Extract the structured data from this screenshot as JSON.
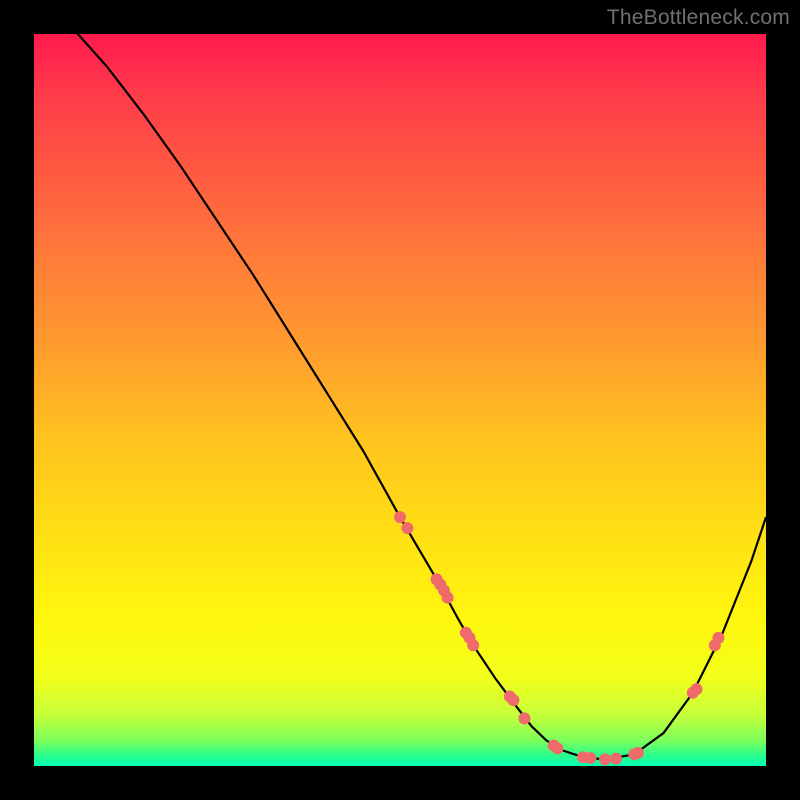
{
  "watermark": "TheBottleneck.com",
  "colors": {
    "background": "#000000",
    "curve": "#000000",
    "dots": "#ef6b6b",
    "watermark": "#707070"
  },
  "chart_data": {
    "type": "line",
    "title": "",
    "xlabel": "",
    "ylabel": "",
    "xlim": [
      0,
      100
    ],
    "ylim": [
      0,
      100
    ],
    "grid": false,
    "x": [
      0,
      3,
      6,
      10,
      15,
      20,
      25,
      30,
      35,
      40,
      45,
      50,
      55,
      58,
      60,
      63,
      66,
      68,
      70,
      72,
      75,
      78,
      82,
      86,
      90,
      94,
      98,
      100
    ],
    "values": [
      106,
      103,
      100,
      95.5,
      89,
      82,
      74.5,
      67,
      59,
      51,
      43,
      34,
      25.5,
      20,
      16.5,
      12,
      8,
      5.4,
      3.5,
      2.2,
      1.2,
      0.9,
      1.6,
      4.5,
      10,
      18,
      28,
      34
    ],
    "series": [
      {
        "name": "dots",
        "type": "scatter",
        "x": [
          50,
          51,
          55,
          55.5,
          56,
          56.5,
          59,
          59.5,
          60,
          65,
          65.5,
          67,
          71,
          71.5,
          75,
          76,
          78,
          79.5,
          82,
          82.5,
          90,
          90.5,
          93,
          93.5
        ],
        "y": [
          34,
          32.5,
          25.5,
          24.8,
          24,
          23,
          18.2,
          17.5,
          16.5,
          9.5,
          9,
          6.5,
          2.8,
          2.4,
          1.2,
          1.1,
          0.9,
          1.0,
          1.6,
          1.8,
          10,
          10.5,
          16.5,
          17.5
        ]
      }
    ]
  }
}
